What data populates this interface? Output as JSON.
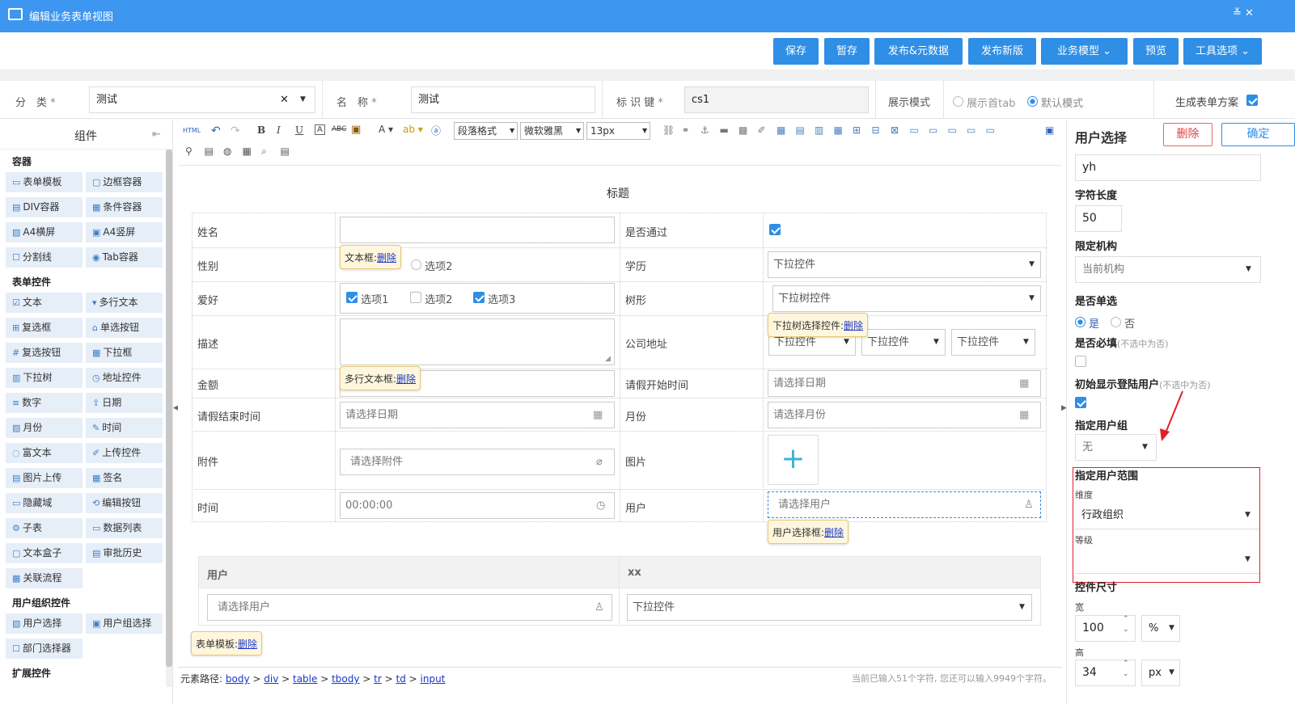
{
  "window": {
    "title": "编辑业务表单视图",
    "controls": "≚ ✕"
  },
  "toolbar": {
    "save": "保存",
    "draft": "暂存",
    "publish_meta": "发布&元数据",
    "publish_new": "发布新版",
    "business_model": "业务模型",
    "preview": "预览",
    "tools": "工具选项"
  },
  "filter": {
    "category_label": "分　类",
    "category_value": "测试",
    "name_label": "名　称",
    "name_value": "测试",
    "key_label": "标 识 键",
    "key_value": "cs1",
    "display_mode_label": "展示模式",
    "mode_first_tab": "展示首tab",
    "mode_default": "默认模式",
    "generate_label": "生成表单方案",
    "required_mark": "*"
  },
  "left": {
    "title": "组件",
    "sections": [
      {
        "title": "容器",
        "items": [
          "表单模板",
          "边框容器",
          "DIV容器",
          "条件容器",
          "A4横屏",
          "A4竖屏",
          "分割线",
          "Tab容器"
        ]
      },
      {
        "title": "表单控件",
        "items": [
          "文本",
          "多行文本",
          "复选框",
          "单选按钮",
          "复选按钮",
          "下拉框",
          "下拉树",
          "地址控件",
          "数字",
          "日期",
          "月份",
          "时间",
          "富文本",
          "上传控件",
          "图片上传",
          "签名",
          "隐藏域",
          "编辑按钮",
          "子表",
          "数据列表",
          "文本盒子",
          "审批历史",
          "关联流程"
        ]
      },
      {
        "title": "用户组织控件",
        "items": [
          "用户选择",
          "用户组选择",
          "部门选择器"
        ]
      },
      {
        "title": "扩展控件",
        "items": []
      }
    ]
  },
  "editor": {
    "paragraph": "段落格式",
    "font": "微软雅黑",
    "size": "13px",
    "html_icon": "HTML"
  },
  "form": {
    "title": "标题",
    "rows": [
      {
        "l1": "姓名",
        "l2": "是否通过"
      },
      {
        "l1": "性别",
        "l2": "学历"
      },
      {
        "l1": "爱好",
        "l2": "树形"
      },
      {
        "l1": "描述",
        "l2": "公司地址"
      },
      {
        "l1": "金额",
        "l2": "请假开始时间"
      },
      {
        "l1": "请假结束时间",
        "l2": "月份"
      },
      {
        "l1": "附件",
        "l2": "图片"
      },
      {
        "l1": "时间",
        "l2": "用户"
      }
    ],
    "option2": "选项2",
    "hobby_options": [
      "选项1",
      "选项2",
      "选项3"
    ],
    "dropdown": "下拉控件",
    "dropdown_tree": "下拉树控件",
    "date_ph": "请选择日期",
    "month_ph": "请选择月份",
    "attach_ph": "请选择附件",
    "time_value": "00:00:00",
    "user_ph": "请选择用户",
    "sub_head_user": "用户",
    "sub_head_xx": "xx"
  },
  "tips": {
    "text": "文本框:",
    "tree": "下拉树选择控件:",
    "multi": "多行文本框:",
    "user": "用户选择框:",
    "template": "表单模板:",
    "delete": "删除"
  },
  "pathbar": {
    "label": "元素路径:",
    "items": [
      "body",
      "div",
      "table",
      "tbody",
      "tr",
      "td",
      "input"
    ],
    "sep": " > ",
    "count": "当前已输入51个字符, 您还可以输入9949个字符。"
  },
  "right": {
    "title": "用户选择",
    "delete": "删除",
    "confirm": "确定",
    "id_value": "yh",
    "len_label": "字符长度",
    "len_value": "50",
    "org_label": "限定机构",
    "org_value": "当前机构",
    "single_label": "是否单选",
    "yes": "是",
    "no": "否",
    "required_label": "是否必填",
    "required_hint": "(不选中为否)",
    "init_label": "初始显示登陆用户",
    "init_hint": "(不选中为否)",
    "group_label": "指定用户组",
    "group_value": "无",
    "range_label": "指定用户范围",
    "dim_label": "维度",
    "dim_value": "行政组织",
    "level_label": "等级",
    "size_label": "控件尺寸",
    "width_label": "宽",
    "width_value": "100",
    "width_unit": "%",
    "height_label": "高",
    "height_value": "34",
    "height_unit": "px"
  },
  "colors": {
    "accent": "#2f8ee5",
    "titlebar": "#3d96ef",
    "annotation": "#e0202a"
  }
}
